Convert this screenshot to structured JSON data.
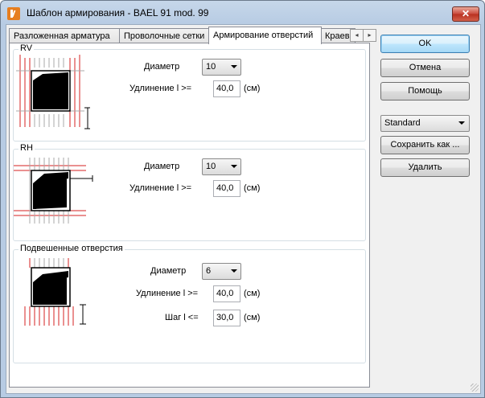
{
  "window": {
    "title": "Шаблон армирования - BAEL 91 mod. 99",
    "close_glyph": "✕"
  },
  "tabs": [
    {
      "label": "Разложенная арматура",
      "active": false
    },
    {
      "label": "Проволочные сетки",
      "active": false
    },
    {
      "label": "Армирование отверстий",
      "active": true
    },
    {
      "label": "Краев",
      "active": false
    }
  ],
  "tab_scroll": {
    "left": "◂",
    "right": "▸"
  },
  "groups": {
    "rv": {
      "title": "RV",
      "diameter_label": "Диаметр",
      "diameter_value": "10",
      "elong_label": "Удлинение l >=",
      "elong_value": "40,0",
      "elong_unit": "(см)"
    },
    "rh": {
      "title": "RH",
      "diameter_label": "Диаметр",
      "diameter_value": "10",
      "elong_label": "Удлинение l >=",
      "elong_value": "40,0",
      "elong_unit": "(см)"
    },
    "hung": {
      "title": "Подвешенные отверстия",
      "diameter_label": "Диаметр",
      "diameter_value": "6",
      "elong_label": "Удлинение l >=",
      "elong_value": "40,0",
      "elong_unit": "(см)",
      "step_label": "Шаг l <=",
      "step_value": "30,0",
      "step_unit": "(см)"
    }
  },
  "buttons": {
    "ok": "OK",
    "cancel": "Отмена",
    "help": "Помощь",
    "save_as": "Сохранить как ...",
    "delete": "Удалить"
  },
  "style_select": {
    "value": "Standard"
  },
  "colors": {
    "rebar": "#d42020",
    "title_bar": "#b7cbe3"
  }
}
